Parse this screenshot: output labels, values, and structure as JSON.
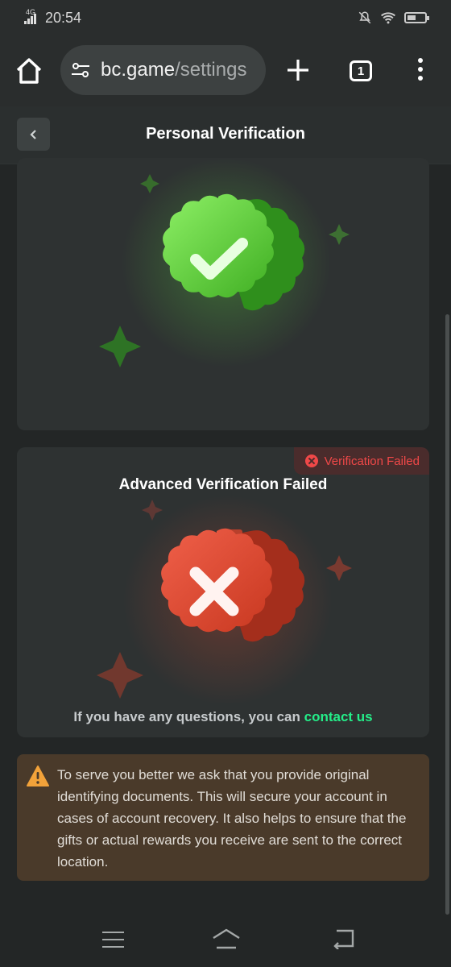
{
  "status_bar": {
    "network": "4G",
    "time": "20:54"
  },
  "browser": {
    "url_domain": "bc.game",
    "url_path": "/settings",
    "tab_count": "1"
  },
  "page": {
    "title": "Personal Verification"
  },
  "advanced": {
    "badge": "Verification Failed",
    "title": "Advanced Verification Failed",
    "contact_prefix": "If you have any questions, you can",
    "contact_link": "contact us"
  },
  "notice": {
    "text": "To serve you better we ask that you provide original identifying documents. This will secure your account in cases of account recovery. It also helps to ensure that the gifts or actual rewards you receive are sent to the correct location."
  },
  "colors": {
    "success_green": "#54d63a",
    "fail_red": "#f04848",
    "link_green": "#24ee89",
    "warning_orange": "#f2a23a"
  }
}
